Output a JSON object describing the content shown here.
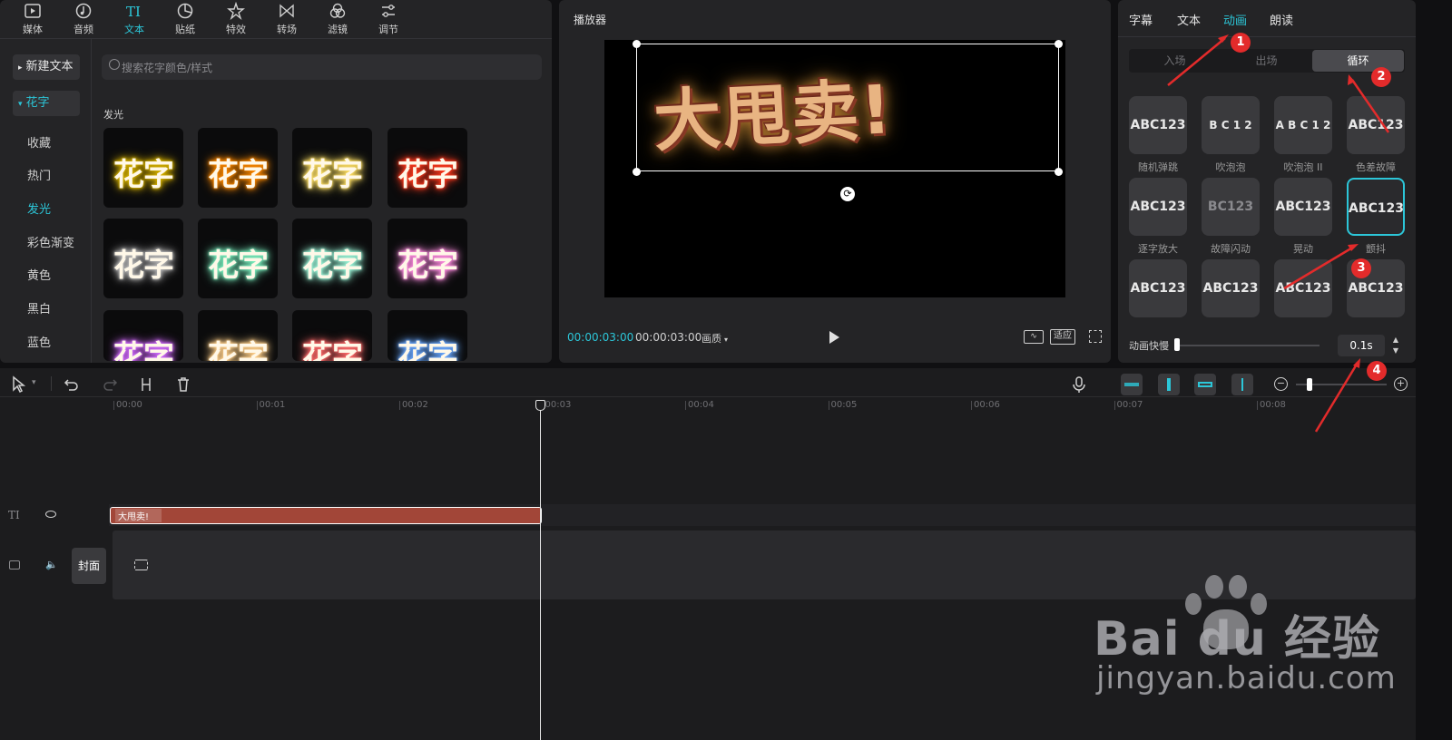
{
  "toolbar": {
    "items": [
      {
        "label": "媒体",
        "icon": "media-icon"
      },
      {
        "label": "音频",
        "icon": "audio-icon"
      },
      {
        "label": "文本",
        "icon": "text-icon"
      },
      {
        "label": "贴纸",
        "icon": "sticker-icon"
      },
      {
        "label": "特效",
        "icon": "effects-icon"
      },
      {
        "label": "转场",
        "icon": "transition-icon"
      },
      {
        "label": "滤镜",
        "icon": "filter-icon"
      },
      {
        "label": "调节",
        "icon": "adjust-icon"
      }
    ],
    "active_index": 2
  },
  "text_panel": {
    "new_text": "新建文本",
    "flower_text": "花字",
    "search_placeholder": "搜索花字颜色/样式",
    "categories": [
      "收藏",
      "热门",
      "发光",
      "彩色渐变",
      "黄色",
      "黑白",
      "蓝色"
    ],
    "active_category": "发光",
    "section_title": "发光",
    "thumb_text": "花字",
    "thumbs_glow_colors": [
      "#d9b400",
      "#ff8a00",
      "#ffe066",
      "#ff3b1f",
      "#b8b8b8",
      "#7df0c0",
      "#9cf5d8",
      "#ff8ee0",
      "#d36cff",
      "#ffcf8a",
      "#ff6b6b",
      "#6aa8ff"
    ]
  },
  "player": {
    "title": "播放器",
    "video_text": "大甩卖!",
    "time_current": "00:00:03:00",
    "time_total": "00:00:03:00",
    "quality": "画质",
    "fit": "适应"
  },
  "right_panel": {
    "tabs": [
      "字幕",
      "文本",
      "动画",
      "朗读"
    ],
    "active_tab": "动画",
    "sub_tabs": [
      "入场",
      "出场",
      "循环"
    ],
    "active_sub_tab": "循环",
    "animations": [
      {
        "label": "随机弹跳",
        "text": "ABC123"
      },
      {
        "label": "吹泡泡",
        "text": "B C 1 2"
      },
      {
        "label": "吹泡泡 II",
        "text": "A B C 1 2"
      },
      {
        "label": "色差故障",
        "text": "ABC123"
      },
      {
        "label": "逐字放大",
        "text": "ABC123"
      },
      {
        "label": "故障闪动",
        "text": "BC123"
      },
      {
        "label": "晃动",
        "text": "ABC123"
      },
      {
        "label": "颤抖",
        "text": "ABC123"
      },
      {
        "label": "",
        "text": "ABC123"
      },
      {
        "label": "",
        "text": "ABC123"
      },
      {
        "label": "",
        "text": "ABC123"
      },
      {
        "label": "",
        "text": "ABC123"
      }
    ],
    "selected_animation": "颤抖",
    "speed_label": "动画快慢",
    "speed_value": "0.1s",
    "speed_fraction": 0.0
  },
  "annotations": [
    "1",
    "2",
    "3",
    "4"
  ],
  "timeline": {
    "ticks": [
      "00:00",
      "00:01",
      "00:02",
      "00:03",
      "00:04",
      "00:05",
      "00:06",
      "00:07",
      "00:08"
    ],
    "text_clip": "大甩卖!",
    "cover": "封面"
  },
  "watermark": {
    "brand": "Bai du 经验",
    "url": "jingyan.baidu.com"
  }
}
